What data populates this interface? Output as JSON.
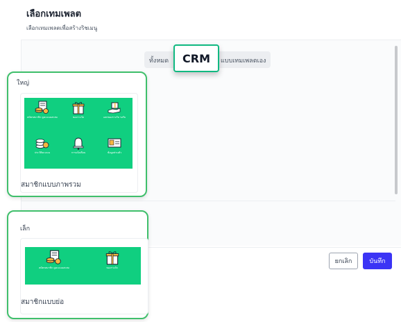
{
  "header": {
    "title": "เลือกเทมเพลต",
    "subtitle": "เลือกเทมเพลตเพื่อสร้างริชเมนู"
  },
  "tabs": {
    "all_label": "ทั้งหมด",
    "own_label": "แบบเทมเพลตเอง",
    "crm_label": "CRM"
  },
  "sections": [
    {
      "label": "ใหญ่",
      "card_name": "สมาชิกแบบภาพรวม",
      "tiles": [
        {
          "label": "สมัครสมาชิก ดูคะแนนสะสม",
          "icon": "member-card-icon"
        },
        {
          "label": "ของรางวัล",
          "icon": "gift-icon"
        },
        {
          "label": "แลกของรางวัล รอรับ",
          "icon": "hand-gift-icon"
        },
        {
          "label": "ประวัติคะแนน",
          "icon": "coins-icon"
        },
        {
          "label": "การแจ้งเตือน",
          "icon": "bell-icon"
        },
        {
          "label": "ข้อมูลส่วนตัว",
          "icon": "profile-card-icon"
        }
      ]
    },
    {
      "label": "เล็ก",
      "card_name": "สมาชิกแบบย่อ",
      "tiles": [
        {
          "label": "สมัครสมาชิก ดูคะแนนสะสม",
          "icon": "member-card-icon"
        },
        {
          "label": "ของรางวัล",
          "icon": "gift-icon"
        }
      ]
    }
  ],
  "footer": {
    "cancel_label": "ยกเลิก",
    "save_label": "บันทึก"
  },
  "colors": {
    "accent": "#10cf80",
    "callout_border": "#3fbf6b",
    "primary_button": "#3b34f5"
  }
}
